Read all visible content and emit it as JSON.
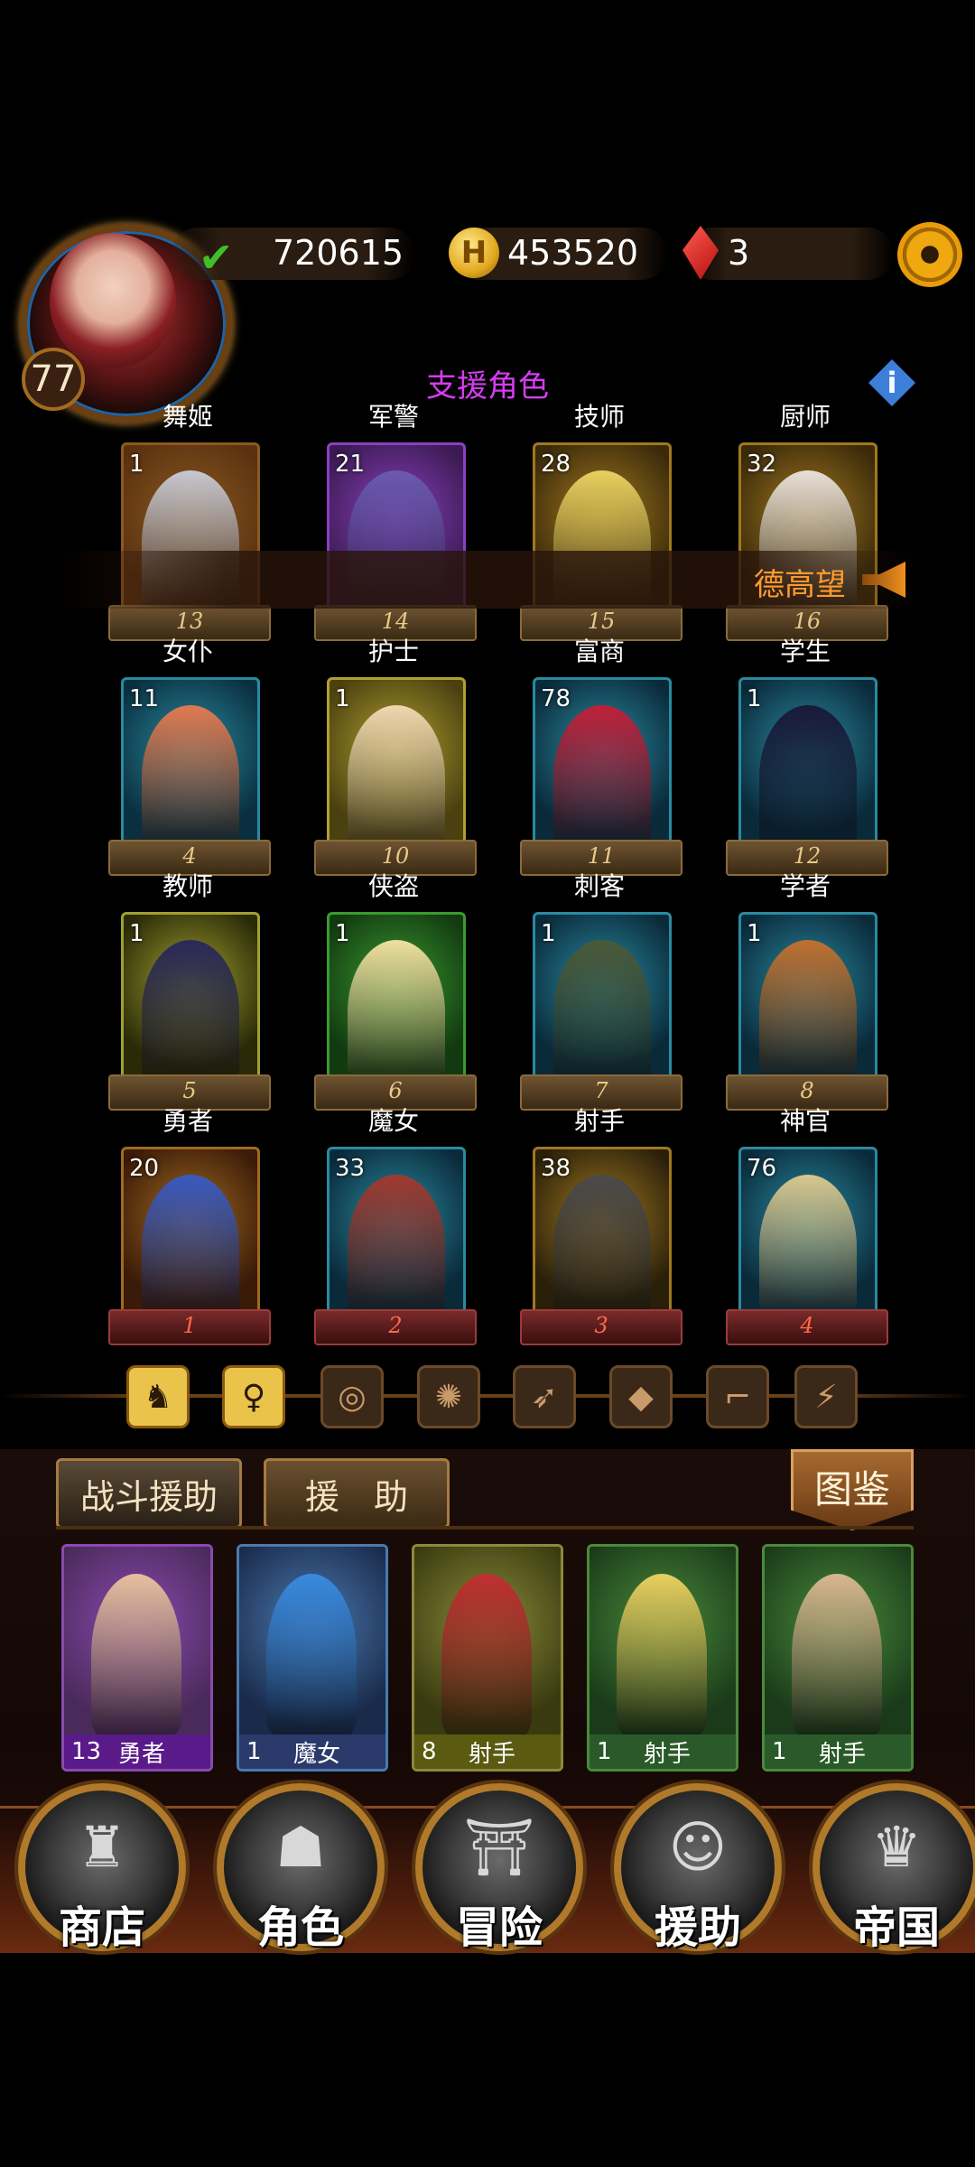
{
  "header": {
    "player_level": "77",
    "experience": "720615",
    "gold": "453520",
    "gold_symbol": "H",
    "gems": "3"
  },
  "section_title": "支援角色",
  "info_icon": "i",
  "announcement": "德高望",
  "cards": [
    {
      "name": "舞姬",
      "level": "1",
      "number": "13",
      "frame": "#8a5a20",
      "bg": "#5a3010",
      "fig": "#c8c8d0"
    },
    {
      "name": "军警",
      "level": "21",
      "number": "14",
      "frame": "#8a40c0",
      "bg": "#3a1a50",
      "fig": "#6a5ab0"
    },
    {
      "name": "技师",
      "level": "28",
      "number": "15",
      "frame": "#a07820",
      "bg": "#3a2a0a",
      "fig": "#e8d060"
    },
    {
      "name": "厨师",
      "level": "32",
      "number": "16",
      "frame": "#a07820",
      "bg": "#3a2a0a",
      "fig": "#e8e0d8"
    },
    {
      "name": "女仆",
      "level": "11",
      "number": "4",
      "frame": "#2a8aa0",
      "bg": "#0a3040",
      "fig": "#e07a50"
    },
    {
      "name": "护士",
      "level": "1",
      "number": "10",
      "frame": "#b0a030",
      "bg": "#4a4010",
      "fig": "#f0d8b0"
    },
    {
      "name": "富商",
      "level": "78",
      "number": "11",
      "frame": "#2a8aa0",
      "bg": "#0a2a3a",
      "fig": "#c0203a"
    },
    {
      "name": "学生",
      "level": "1",
      "number": "12",
      "frame": "#2a8aa0",
      "bg": "#0a2a3a",
      "fig": "#1a1a3a"
    },
    {
      "name": "教师",
      "level": "1",
      "number": "5",
      "frame": "#a0a030",
      "bg": "#2a2a08",
      "fig": "#2a2a5a"
    },
    {
      "name": "侠盗",
      "level": "1",
      "number": "6",
      "frame": "#3a9a30",
      "bg": "#123a10",
      "fig": "#f0e0a0"
    },
    {
      "name": "刺客",
      "level": "1",
      "number": "7",
      "frame": "#2a8aa0",
      "bg": "#0a2a3a",
      "fig": "#4a5a3a"
    },
    {
      "name": "学者",
      "level": "1",
      "number": "8",
      "frame": "#2a8aa0",
      "bg": "#0a2a3a",
      "fig": "#c07030"
    },
    {
      "name": "勇者",
      "level": "20",
      "number": "1",
      "frame": "#a06a20",
      "bg": "#3a1a08",
      "fig": "#3a5ac0"
    },
    {
      "name": "魔女",
      "level": "33",
      "number": "2",
      "frame": "#2a8aa0",
      "bg": "#0a2a3a",
      "fig": "#a03a30"
    },
    {
      "name": "射手",
      "level": "38",
      "number": "3",
      "frame": "#a07820",
      "bg": "#2a200a",
      "fig": "#4a4a4a"
    },
    {
      "name": "神官",
      "level": "76",
      "number": "4",
      "frame": "#2a8aa0",
      "bg": "#0a2a3a",
      "fig": "#d8c890"
    }
  ],
  "filters": [
    {
      "icon": "beast-icon",
      "glyph": "♞"
    },
    {
      "icon": "woman-icon",
      "glyph": "♀"
    },
    {
      "icon": "target-icon",
      "glyph": "◎"
    },
    {
      "icon": "wheel-icon",
      "glyph": "✺"
    },
    {
      "icon": "bow-icon",
      "glyph": "➶"
    },
    {
      "icon": "diamond-icon",
      "glyph": "◆"
    },
    {
      "icon": "boot-icon",
      "glyph": "⌐"
    },
    {
      "icon": "claw-icon",
      "glyph": "⚡"
    }
  ],
  "tabs": {
    "battle_support": "战斗援助",
    "support": "援　助",
    "codex": "图鉴"
  },
  "heroes": [
    {
      "count": "13",
      "class": "勇者",
      "border": "#8a4ab0",
      "bg": "#4a2a5a",
      "foot": "#5a1a8a",
      "fig": "#e8c0a0"
    },
    {
      "count": "1",
      "class": "魔女",
      "border": "#4a7ab0",
      "bg": "#1a2a4a",
      "foot": "#2a3a6a",
      "fig": "#3a8ae0"
    },
    {
      "count": "8",
      "class": "射手",
      "border": "#8a8a3a",
      "bg": "#3a3a10",
      "foot": "#5a5a10",
      "fig": "#c03030"
    },
    {
      "count": "1",
      "class": "射手",
      "border": "#4a8a3a",
      "bg": "#1a3a1a",
      "foot": "#2a5a2a",
      "fig": "#e8d060"
    },
    {
      "count": "1",
      "class": "射手",
      "border": "#4a8a3a",
      "bg": "#1a3a1a",
      "foot": "#2a5a2a",
      "fig": "#d8b890"
    }
  ],
  "nav": [
    {
      "label": "商店",
      "icon": "castle-icon",
      "glyph": "♜"
    },
    {
      "label": "角色",
      "icon": "hood-icon",
      "glyph": "☗"
    },
    {
      "label": "冒险",
      "icon": "portal-icon",
      "glyph": "⛩"
    },
    {
      "label": "援助",
      "icon": "girl-icon",
      "glyph": "☺"
    },
    {
      "label": "帝国",
      "icon": "crown-icon",
      "glyph": "♛"
    }
  ]
}
